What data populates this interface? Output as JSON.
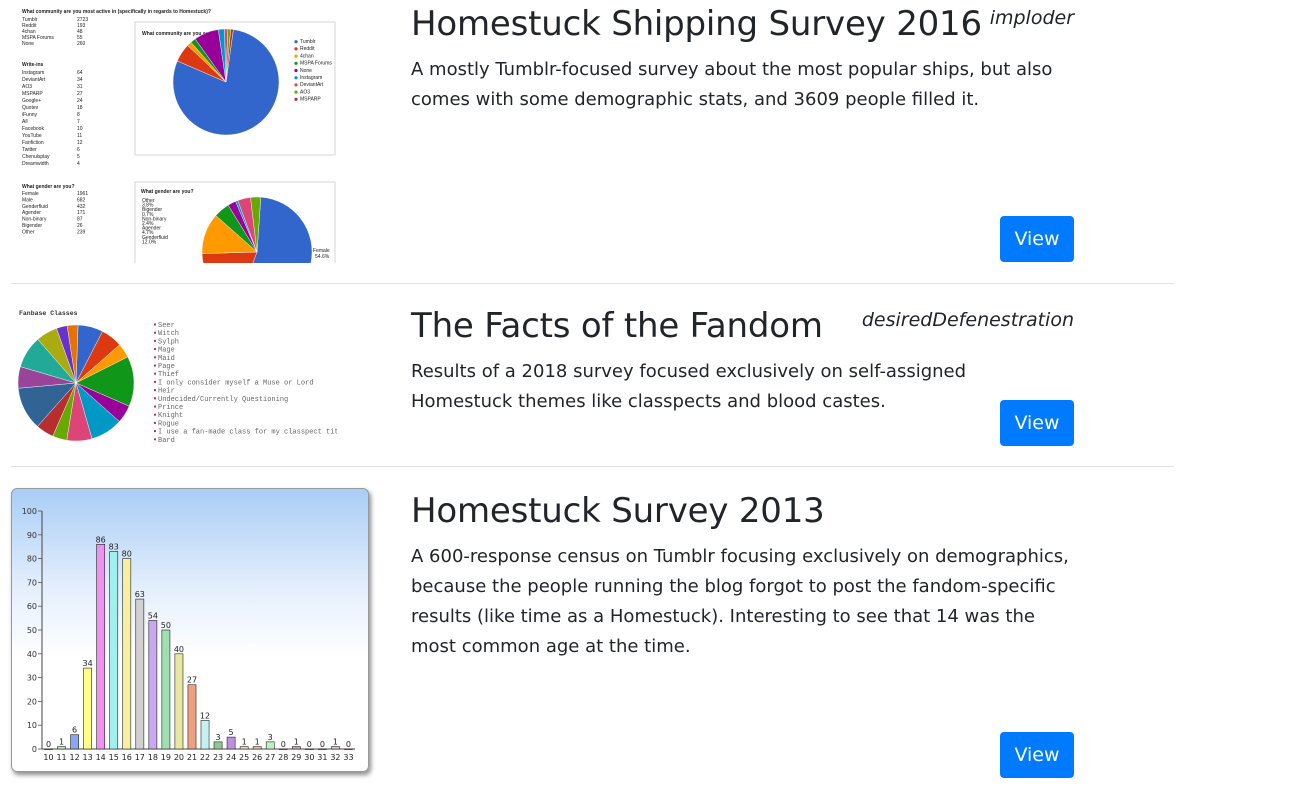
{
  "entries": [
    {
      "title": "Homestuck Shipping Survey 2016",
      "author": "imploder",
      "description": "A mostly Tumblr-focused survey about the most popular ships, but also comes with some demographic stats, and 3609 people filled it.",
      "button": "View"
    },
    {
      "title": "The Facts of the Fandom",
      "author": "desiredDefenestration",
      "description": "Results of a 2018 survey focused exclusively on self-assigned Homestuck themes like classpects and blood castes.",
      "button": "View"
    },
    {
      "title": "Homestuck Survey 2013",
      "author": "",
      "description": "A 600-response census on Tumblr focusing exclusively on demographics, because the people running the blog forgot to post the fandom-specific results (like time as a Homestuck). Interesting to see that 14 was the most common age at the time.",
      "button": "View"
    }
  ],
  "thumb1": {
    "q1": "What community are you most active in (specifically in regards to Homestuck)?",
    "q1_rows": [
      [
        "Tumblr",
        "2723"
      ],
      [
        "Reddit",
        "193"
      ],
      [
        "4chan",
        "48"
      ],
      [
        "MSPA Forums",
        "55"
      ],
      [
        "None",
        "260"
      ]
    ],
    "writeins_label": "Write-ins",
    "writeins_rows": [
      [
        "Instagram",
        "64"
      ],
      [
        "DeviantArt",
        "34"
      ],
      [
        "AO3",
        "31"
      ],
      [
        "MSPARP",
        "27"
      ],
      [
        "Google+",
        "24"
      ],
      [
        "Quotev",
        "18"
      ],
      [
        "iFunny",
        "8"
      ],
      [
        "All",
        "7"
      ],
      [
        "Facebook",
        "10"
      ],
      [
        "YouTube",
        "11"
      ],
      [
        "Fanfiction",
        "12"
      ],
      [
        "Twitter",
        "6"
      ],
      [
        "Chenulsplay",
        "5"
      ],
      [
        "Dreamwidth",
        "4"
      ]
    ],
    "q2": "What gender are you?",
    "q2_rows": [
      [
        "Female",
        "1961"
      ],
      [
        "Male",
        "682"
      ],
      [
        "Genderfluid",
        "432"
      ],
      [
        "Agender",
        "171"
      ],
      [
        "Non-binary",
        "87"
      ],
      [
        "Bigender",
        "26"
      ],
      [
        "Other",
        "239"
      ]
    ],
    "chart1_title": "What community are you active in?",
    "chart1_legend": [
      "Tumblr",
      "Reddit",
      "4chan",
      "MSPA Forums",
      "None",
      "Instagram",
      "DeviantArt",
      "AO3",
      "MSPARP"
    ],
    "chart2_title": "What gender are you?",
    "chart2_labels": [
      "Other",
      "3.8%",
      "Bigender",
      "0.7%",
      "Non-binary",
      "2.4%",
      "Agender",
      "4.7%",
      "Genderfluid",
      "12.0%"
    ],
    "chart2_female": "Female",
    "chart2_female_pct": "54.6%"
  },
  "thumb2": {
    "title": "Fanbase Classes",
    "legend": [
      "Seer",
      "Witch",
      "Sylph",
      "Mage",
      "Maid",
      "Page",
      "Thief",
      "I only consider myself a Muse or Lord",
      "Heir",
      "Undecided/Currently Questioning",
      "Prince",
      "Knight",
      "Rogue",
      "I use a fan-made class for my classpect title",
      "Bard"
    ]
  },
  "chart_data": {
    "type": "bar",
    "categories": [
      "10",
      "11",
      "12",
      "13",
      "14",
      "15",
      "16",
      "17",
      "18",
      "19",
      "20",
      "21",
      "22",
      "23",
      "24",
      "25",
      "26",
      "27",
      "28",
      "29",
      "30",
      "31",
      "32",
      "33"
    ],
    "values": [
      0,
      1,
      6,
      34,
      86,
      83,
      80,
      63,
      54,
      50,
      40,
      27,
      12,
      3,
      5,
      1,
      1,
      3,
      0,
      1,
      0,
      0,
      1,
      0
    ],
    "ylim": [
      0,
      100
    ],
    "yticks": [
      0,
      10,
      20,
      30,
      40,
      50,
      60,
      70,
      80,
      90,
      100
    ],
    "colors": [
      "#ffffff",
      "#b8f0b8",
      "#8ba7f0",
      "#ffff88",
      "#f090f0",
      "#a0f0f0",
      "#f8f0a0",
      "#d0d0d0",
      "#c8a8f0",
      "#a0e0b0",
      "#e8e8a0",
      "#f0a080",
      "#c8f0f0",
      "#90c890",
      "#c090e0",
      "#f0e0a0",
      "#f0c0a0",
      "#c0f0c0",
      "#ffffff",
      "#e0a0a0",
      "#ffffff",
      "#ffffff",
      "#f0c0c0",
      "#ffffff"
    ]
  }
}
